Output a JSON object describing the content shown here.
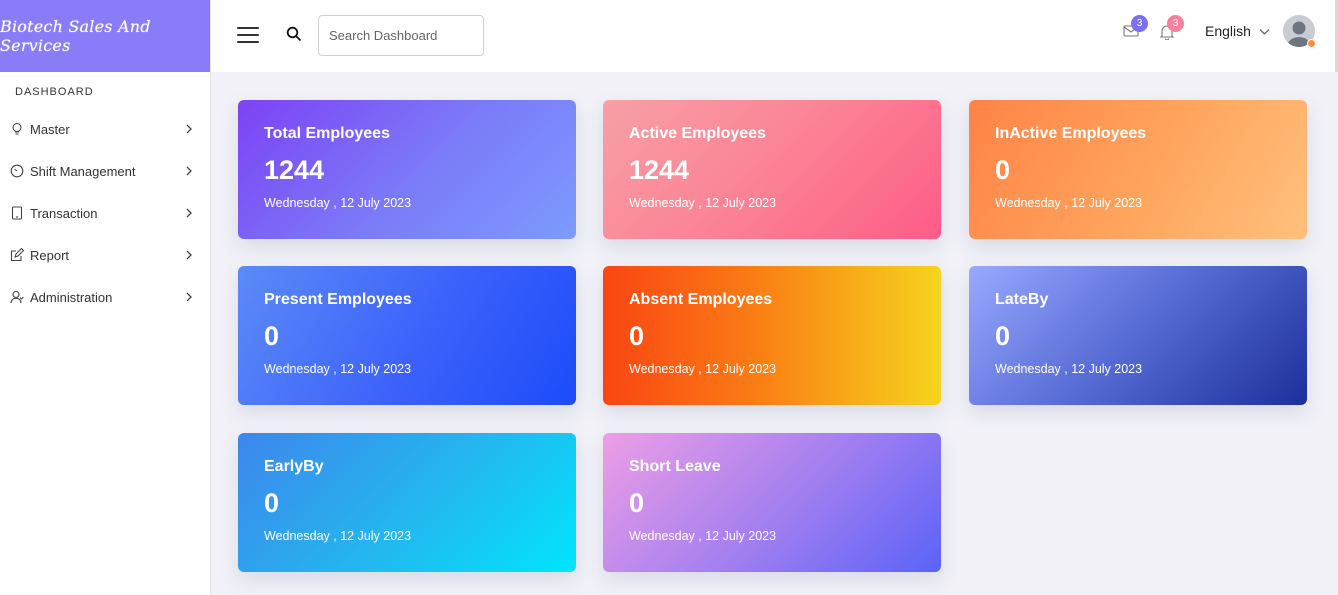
{
  "brand": {
    "name": "Biotech Sales And Services"
  },
  "sidebar": {
    "section_title": "DASHBOARD",
    "items": [
      {
        "label": "Master",
        "icon": "lightbulb-icon"
      },
      {
        "label": "Shift Management",
        "icon": "gauge-icon"
      },
      {
        "label": "Transaction",
        "icon": "tablet-icon"
      },
      {
        "label": "Report",
        "icon": "edit-icon"
      },
      {
        "label": "Administration",
        "icon": "users-icon"
      }
    ]
  },
  "topbar": {
    "search_placeholder": "Search Dashboard",
    "mail_count": "3",
    "notification_count": "3",
    "language": "English"
  },
  "cards": [
    {
      "title": "Total Employees",
      "value": "1244",
      "date": "Wednesday , 12 July 2023"
    },
    {
      "title": "Active Employees",
      "value": "1244",
      "date": "Wednesday , 12 July 2023"
    },
    {
      "title": "InActive Employees",
      "value": "0",
      "date": "Wednesday , 12 July 2023"
    },
    {
      "title": "Present Employees",
      "value": "0",
      "date": "Wednesday , 12 July 2023"
    },
    {
      "title": "Absent Employees",
      "value": "0",
      "date": "Wednesday , 12 July 2023"
    },
    {
      "title": "LateBy",
      "value": "0",
      "date": "Wednesday , 12 July 2023"
    },
    {
      "title": "EarlyBy",
      "value": "0",
      "date": "Wednesday , 12 July 2023"
    },
    {
      "title": "Short Leave",
      "value": "0",
      "date": "Wednesday , 12 July 2023"
    }
  ],
  "colors": {
    "brand_bg": "#8a7cf8",
    "badge_mail": "#7c6ef5",
    "badge_bell": "#f87f9e",
    "avatar_status": "#ff8b3d"
  }
}
